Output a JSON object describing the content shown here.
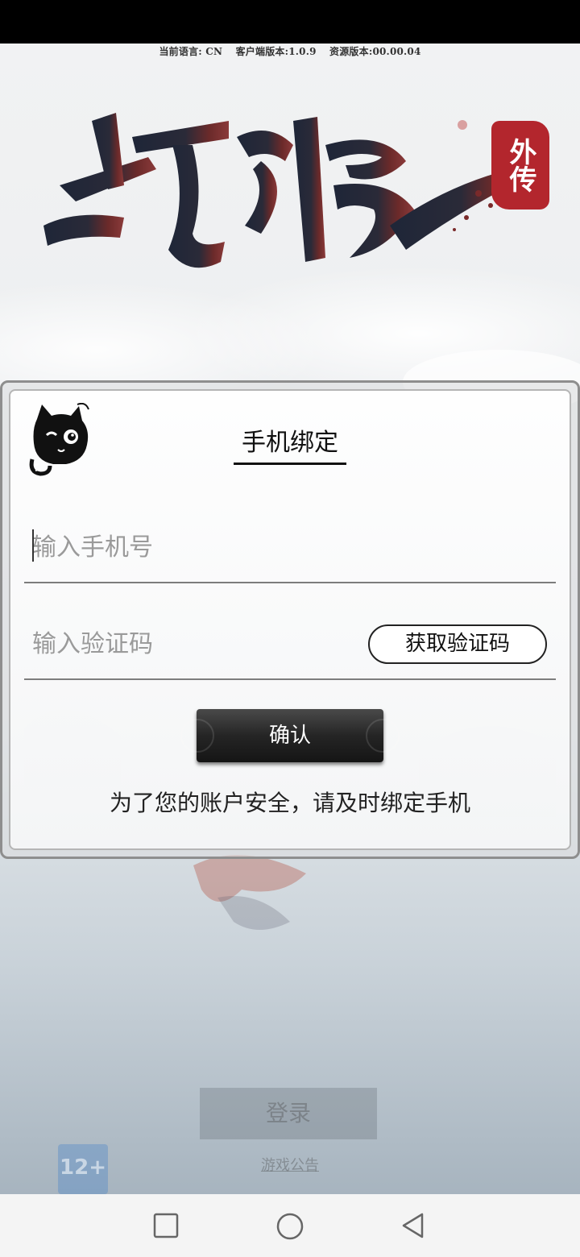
{
  "header": {
    "language": "当前语言: CN",
    "client_version": "客户端版本:1.0.9",
    "resource_version": "资源版本:00.00.04"
  },
  "logo": {
    "stamp_text": "外传"
  },
  "dialog": {
    "title": "手机绑定",
    "phone_placeholder": "输入手机号",
    "code_placeholder": "输入验证码",
    "get_code_label": "获取验证码",
    "confirm_label": "确认",
    "notice": "为了您的账户安全，请及时绑定手机"
  },
  "background": {
    "login_label": "登录",
    "notice_link": "游戏公告",
    "age_badge": "12+"
  },
  "nav": {
    "icons": [
      "square-recent-icon",
      "circle-home-icon",
      "triangle-back-icon"
    ]
  },
  "colors": {
    "stamp_red": "#b3262d",
    "logo_dark": "#1e2638",
    "logo_red": "#7a2a2a"
  }
}
